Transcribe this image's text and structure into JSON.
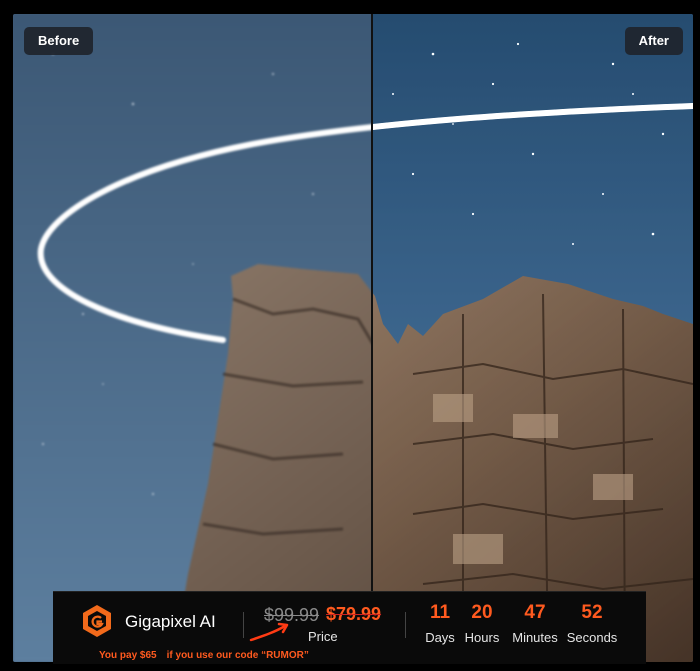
{
  "viewer": {
    "before_label": "Before",
    "after_label": "After"
  },
  "promo": {
    "product_name": "Gigapixel AI",
    "old_price": "$99.99",
    "new_price": "$79.99",
    "price_label": "Price",
    "countdown": [
      {
        "value": "11",
        "label": "Days"
      },
      {
        "value": "20",
        "label": "Hours"
      },
      {
        "value": "47",
        "label": "Minutes"
      },
      {
        "value": "52",
        "label": "Seconds"
      }
    ],
    "note_pay": "You pay $65",
    "note_code": "if you use our code “RUMOR”",
    "accent_color": "#ff5a1f"
  }
}
